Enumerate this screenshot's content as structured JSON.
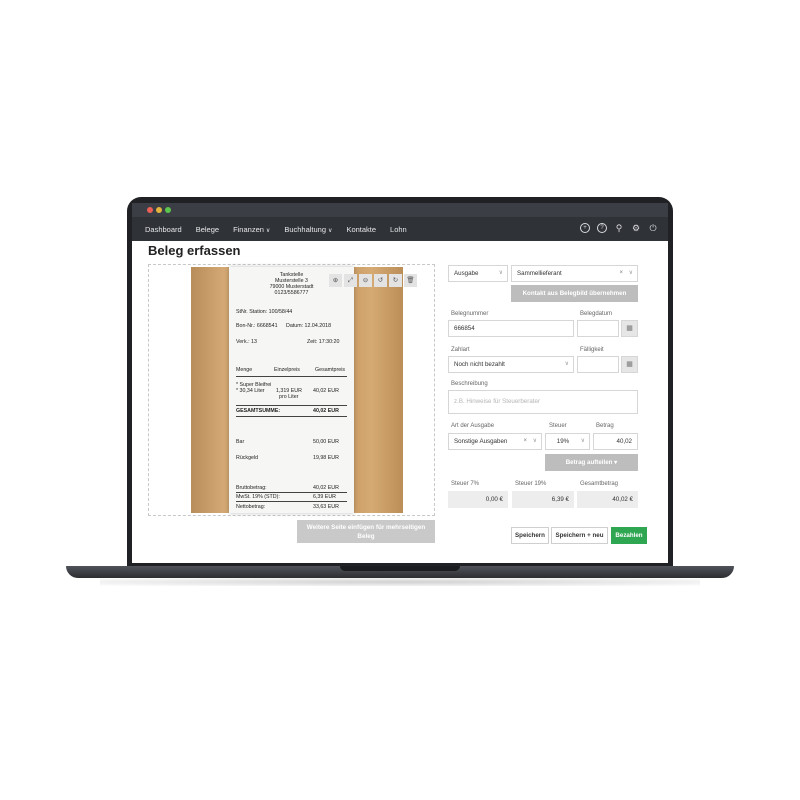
{
  "nav": {
    "items": [
      {
        "label": "Dashboard",
        "dropdown": false
      },
      {
        "label": "Belege",
        "dropdown": false
      },
      {
        "label": "Finanzen",
        "dropdown": true
      },
      {
        "label": "Buchhaltung",
        "dropdown": true
      },
      {
        "label": "Kontakte",
        "dropdown": false
      },
      {
        "label": "Lohn",
        "dropdown": false
      }
    ],
    "icons": [
      "plus-circle-icon",
      "help-icon",
      "search-icon",
      "settings-icon",
      "power-icon"
    ]
  },
  "page": {
    "title": "Beleg erfassen"
  },
  "receipt": {
    "header_1": "Tankstelle",
    "header_2": "Musterstelle 3",
    "header_3": "79000 Musterstadt",
    "header_4": "0123/5586777",
    "station": "StNr. Station: 100/58/44",
    "bon": "Bon-Nr.: 6668541",
    "datum": "Datum: 12.04.2018",
    "verk": "Verk.: 13",
    "zeit": "Zeit: 17:30:20",
    "col_menge": "Menge",
    "col_einzel": "Einzelpreis",
    "col_gesamt": "Gesamtpreis",
    "item_name": "* Super Bleifrei",
    "item_qty": "* 30,34 Liter",
    "item_unit": "1,319 EUR",
    "item_unit_2": "pro Liter",
    "item_total": "40,02 EUR",
    "sum_label": "GESAMTSUMME:",
    "sum_value": "40,02 EUR",
    "bar_label": "Bar",
    "bar_value": "50,00 EUR",
    "rueck_label": "Rückgeld",
    "rueck_value": "19,98 EUR",
    "brutto_label": "Bruttobetrag:",
    "brutto_value": "40,02 EUR",
    "mwst_label": "MwSt. 19% (STD):",
    "mwst_value": "6,39 EUR",
    "netto_label": "Nettobetrag:",
    "netto_value": "33,63 EUR"
  },
  "tools": [
    {
      "name": "zoom-in-icon",
      "glyph": "⊕"
    },
    {
      "name": "expand-icon",
      "glyph": "⤢"
    },
    {
      "name": "zoom-out-icon",
      "glyph": "⊖"
    },
    {
      "name": "rotate-left-icon",
      "glyph": "↺"
    },
    {
      "name": "rotate-right-icon",
      "glyph": "↻"
    },
    {
      "name": "trash-icon",
      "glyph": "🗑"
    }
  ],
  "add_page_button": {
    "line1": "Weitere Seite einfügen für mehrseitigen",
    "line2": "Beleg"
  },
  "form": {
    "type_value": "Ausgabe",
    "contact_value": "Sammellieferant",
    "contact_button": "Kontakt aus Belegbild übernehmen",
    "belegnummer_label": "Belegnummer",
    "belegnummer_value": "666854",
    "belegdatum_label": "Belegdatum",
    "zahlart_label": "Zahlart",
    "zahlart_value": "Noch nicht bezahlt",
    "faelligkeit_label": "Fälligkeit",
    "beschreibung_label": "Beschreibung",
    "beschreibung_placeholder": "z.B. Hinweise für Steuerberater",
    "art_label": "Art der Ausgabe",
    "art_value": "Sonstige Ausgaben",
    "steuer_label": "Steuer",
    "steuer_value": "19%",
    "betrag_label": "Betrag",
    "betrag_value": "40,02",
    "split_button": "Betrag aufteilen ▾",
    "tax7_label": "Steuer 7%",
    "tax7_value": "0,00 €",
    "tax19_label": "Steuer 19%",
    "tax19_value": "6,39 €",
    "gesamt_label": "Gesamtbetrag",
    "gesamt_value": "40,02 €"
  },
  "actions": {
    "save": "Speichern",
    "save_new": "Speichern + neu",
    "pay": "Bezahlen"
  }
}
